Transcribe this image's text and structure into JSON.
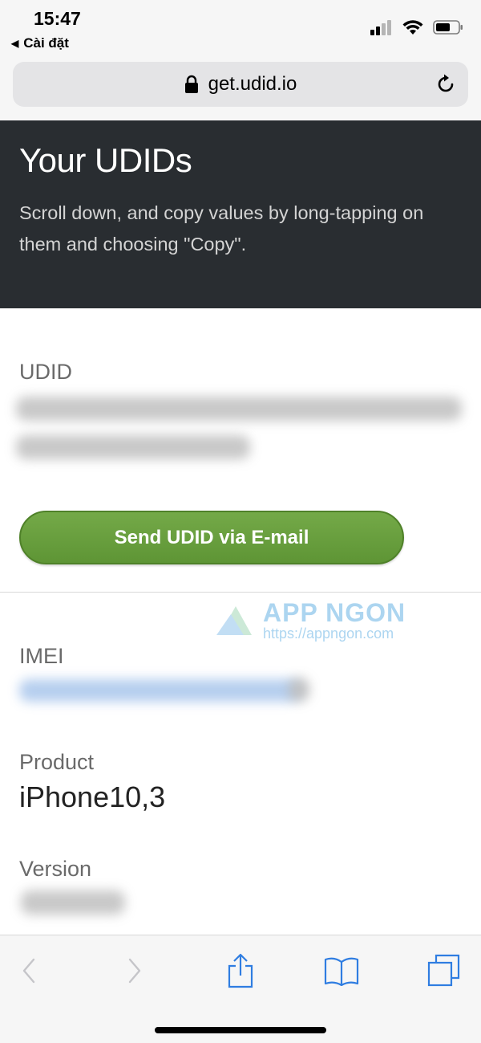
{
  "status_bar": {
    "time": "15:47",
    "back_app": "Cài đặt",
    "signal_icon": "cellular-signal-icon",
    "wifi_icon": "wifi-icon",
    "battery_icon": "battery-icon"
  },
  "address_bar": {
    "lock_icon": "lock-icon",
    "url": "get.udid.io",
    "reload_icon": "reload-icon"
  },
  "header": {
    "title": "Your UDIDs",
    "subtitle": "Scroll down, and copy values by long-tapping on them and choosing \"Copy\"."
  },
  "udid": {
    "label": "UDID",
    "value_hidden": true
  },
  "send_button": {
    "label": "Send UDID via E-mail",
    "color": "#68a03e"
  },
  "watermark": {
    "name": "APP NGON",
    "url": "https://appngon.com"
  },
  "imei": {
    "label": "IMEI",
    "value_hidden": true
  },
  "product": {
    "label": "Product",
    "value": "iPhone10,3"
  },
  "version": {
    "label": "Version",
    "value_hidden": true
  },
  "toolbar": {
    "back_icon": "chevron-left-icon",
    "forward_icon": "chevron-right-icon",
    "share_icon": "share-icon",
    "bookmarks_icon": "book-icon",
    "tabs_icon": "tabs-icon",
    "accent": "#2f7de1"
  }
}
